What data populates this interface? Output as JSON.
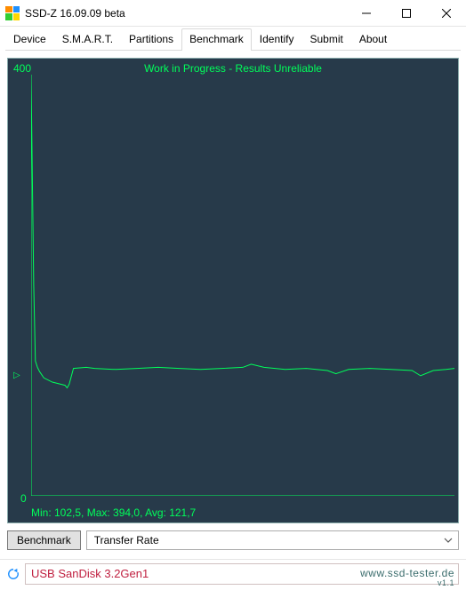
{
  "window": {
    "title": "SSD-Z 16.09.09 beta"
  },
  "tabs": [
    "Device",
    "S.M.A.R.T.",
    "Partitions",
    "Benchmark",
    "Identify",
    "Submit",
    "About"
  ],
  "active_tab_index": 3,
  "controls": {
    "benchmark_button": "Benchmark",
    "mode_selected": "Transfer Rate"
  },
  "status": {
    "device": "USB SanDisk 3.2Gen1",
    "watermark_main": "www.ssd-tester.de",
    "watermark_sub": "v1.1"
  },
  "chart_data": {
    "type": "line",
    "title": "Work in Progress - Results Unreliable",
    "ylabel": "",
    "xlabel": "",
    "ylim": [
      0,
      400
    ],
    "y_ticks": [
      0,
      400
    ],
    "stats_text": "Min: 102,5, Max: 394,0, Avg: 121,7",
    "stats": {
      "min": 102.5,
      "max": 394.0,
      "avg": 121.7
    },
    "series": [
      {
        "name": "Transfer Rate (MB/s)",
        "x_normalized": [
          0,
          0.003,
          0.006,
          0.01,
          0.015,
          0.02,
          0.03,
          0.05,
          0.08,
          0.085,
          0.09,
          0.1,
          0.13,
          0.15,
          0.2,
          0.25,
          0.3,
          0.35,
          0.4,
          0.45,
          0.5,
          0.52,
          0.55,
          0.6,
          0.65,
          0.7,
          0.72,
          0.75,
          0.8,
          0.85,
          0.9,
          0.92,
          0.95,
          0.98,
          1.0
        ],
        "values": [
          394,
          300,
          200,
          128,
          122,
          118,
          112,
          108,
          105,
          102.5,
          106,
          121,
          122,
          121,
          120,
          121,
          122,
          121,
          120,
          121,
          122,
          125,
          122,
          120,
          121,
          119,
          116,
          120,
          121,
          120,
          119,
          114,
          119,
          120,
          121
        ]
      }
    ]
  }
}
